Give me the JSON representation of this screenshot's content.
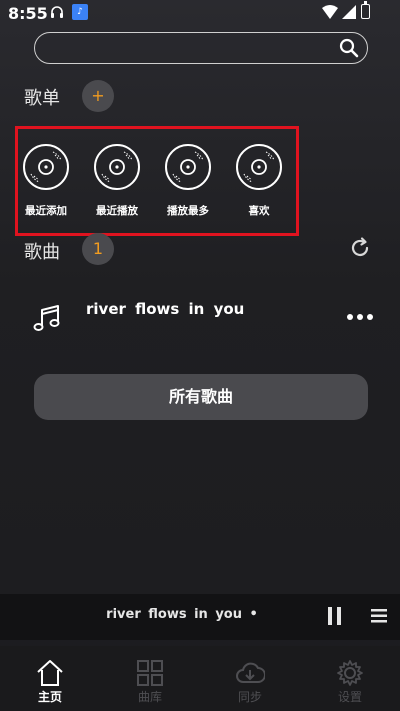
{
  "status_bar": {
    "time": "8:55",
    "notif_icon": "app-notification-icon"
  },
  "search": {
    "placeholder": "",
    "value": ""
  },
  "playlists": {
    "label": "歌单",
    "add_label": "+",
    "items": [
      {
        "label": "最近添加",
        "icon": "disc-icon"
      },
      {
        "label": "最近播放",
        "icon": "disc-icon"
      },
      {
        "label": "播放最多",
        "icon": "disc-icon"
      },
      {
        "label": "喜欢",
        "icon": "disc-icon"
      }
    ]
  },
  "songs": {
    "label": "歌曲",
    "count": "1",
    "list": [
      {
        "title": "river  flows  in  you"
      }
    ],
    "all_songs_label": "所有歌曲"
  },
  "mini_player": {
    "now_playing": "river  flows  in  you •"
  },
  "bottom_nav": [
    {
      "label": "主页",
      "active": true
    },
    {
      "label": "曲库",
      "active": false
    },
    {
      "label": "同步",
      "active": false
    },
    {
      "label": "设置",
      "active": false
    }
  ],
  "colors": {
    "accent": "#f29c1f",
    "highlight_border": "#e0131f",
    "background": "#1f1f22"
  }
}
